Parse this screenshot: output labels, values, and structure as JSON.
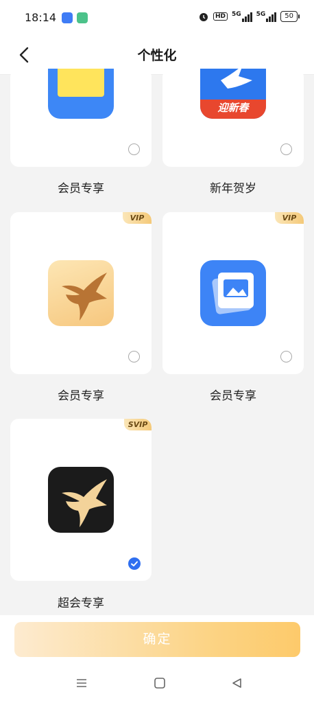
{
  "status_bar": {
    "time": "18:14",
    "hd_label": "HD",
    "signal1_label": "5G",
    "signal2_label": "5G",
    "battery": "50"
  },
  "header": {
    "title": "个性化"
  },
  "icons": [
    {
      "label": "会员专享",
      "badge": "",
      "selected": false
    },
    {
      "label": "新年贺岁",
      "badge": "",
      "selected": false,
      "banner_text": "迎新春"
    },
    {
      "label": "会员专享",
      "badge": "VIP",
      "selected": false
    },
    {
      "label": "会员专享",
      "badge": "VIP",
      "selected": false
    },
    {
      "label": "超会专享",
      "badge": "SVIP",
      "selected": true
    }
  ],
  "confirm_label": "确定",
  "colors": {
    "accent_blue": "#2f6ff0",
    "confirm_gradient_start": "#fdebd0",
    "confirm_gradient_end": "#fdca6b",
    "vip_badge": "#f4c979"
  }
}
